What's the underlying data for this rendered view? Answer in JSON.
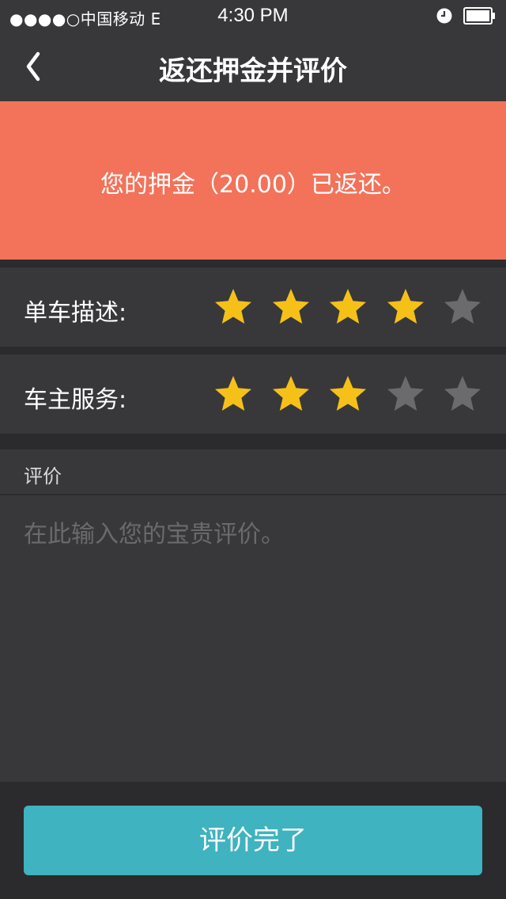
{
  "status_bar": {
    "carrier": "●●●●○中国移动  E",
    "time": "4:30 PM",
    "icons": [
      "clock-icon",
      "battery-icon"
    ]
  },
  "nav": {
    "title": "返还押金并评价",
    "back_icon": "chevron-left-icon"
  },
  "banner": {
    "message": "您的押金（20.00）已返还。",
    "color": "#f2735a"
  },
  "ratings": [
    {
      "label": "单车描述:",
      "score": 4,
      "max": 5
    },
    {
      "label": "车主服务:",
      "score": 3,
      "max": 5
    }
  ],
  "review": {
    "header": "评价",
    "placeholder": "在此输入您的宝贵评价。",
    "value": ""
  },
  "submit": {
    "label": "评价完了",
    "color": "#3fb3bf"
  },
  "colors": {
    "star_filled": "#f5c118",
    "star_empty": "#6b6b6e",
    "panel": "#38383b",
    "background": "#2b2b2d"
  }
}
